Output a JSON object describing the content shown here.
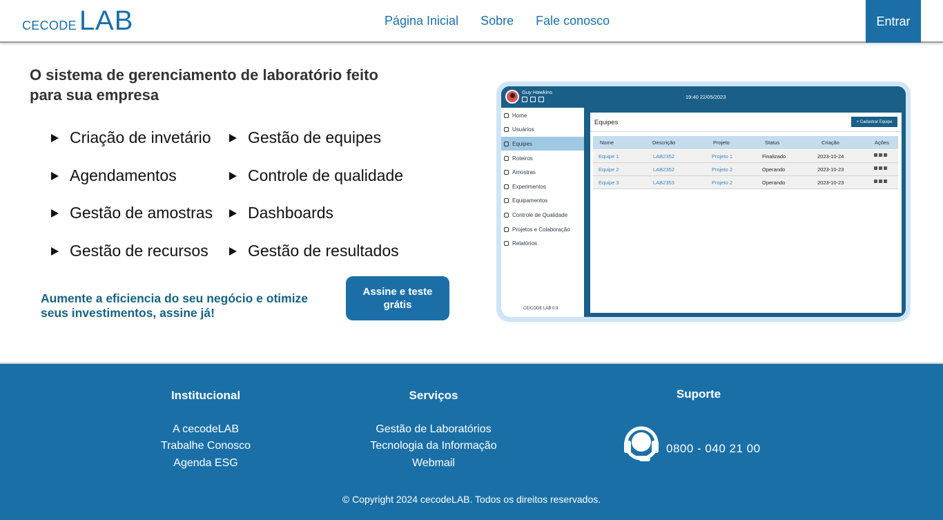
{
  "header": {
    "logo_small": "CECODE",
    "logo_big": "LAB",
    "nav": [
      "Página Inicial",
      "Sobre",
      "Fale conosco"
    ],
    "login_label": "Entrar"
  },
  "hero": {
    "title": "O sistema de gerenciamento de laboratório feito para sua empresa",
    "features_left": [
      "Criação de invetário",
      "Agendamentos",
      "Gestão de amostras",
      "Gestão de recursos"
    ],
    "features_right": [
      "Gestão de equipes",
      "Controle de qualidade",
      "Dashboards",
      "Gestão de resultados"
    ],
    "cta_text": "Aumente a eficiencia do seu negócio e otimize seus investimentos, assine já!",
    "cta_button": "Assine e teste grátis"
  },
  "mock": {
    "user": "Guy Hawkins",
    "time": "19:40  22/05/2023",
    "sidebar": [
      "Home",
      "Usuários",
      "Equipes",
      "Roteiros",
      "Amostras",
      "Experimentos",
      "Equipamentos",
      "Controle de Qualidade",
      "Projetos e Colaboração",
      "Relatórios"
    ],
    "active_item": "Equipes",
    "version": "CE/CODE LAB 0.9",
    "main_title": "Equipes",
    "add_button": "+ Cadastrar Equipe",
    "columns": [
      "Nome",
      "Descrição",
      "Projeto",
      "Status",
      "Criação",
      "Ações"
    ],
    "rows": [
      [
        "Equipe 1",
        "LAB2352",
        "Projeto 1",
        "Finalizado",
        "2023-10-24"
      ],
      [
        "Equipe 2",
        "LAB2352",
        "Projeto 2",
        "Operando",
        "2023-10-23"
      ],
      [
        "Equipe 3",
        "LAB2353",
        "Projeto 2",
        "Operando",
        "2023-10-23"
      ]
    ]
  },
  "footer": {
    "institucional": {
      "title": "Institucional",
      "links": [
        "A cecodeLAB",
        "Trabalhe Conosco",
        "Agenda ESG"
      ]
    },
    "servicos": {
      "title": "Serviços",
      "links": [
        "Gestão de Laboratórios",
        "Tecnologia da Informação",
        "Webmail"
      ]
    },
    "suporte": {
      "title": "Suporte",
      "phone": "0800 - 040 21 00"
    },
    "copyright": "© Copyright 2024 cecodeLAB. Todos os direitos reservados."
  }
}
